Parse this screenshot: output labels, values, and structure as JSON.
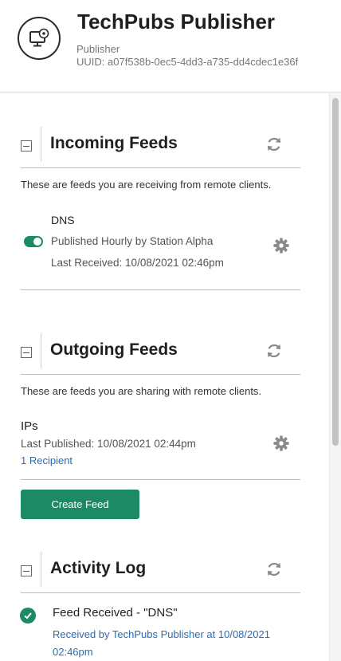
{
  "header": {
    "title": "TechPubs Publisher",
    "role": "Publisher",
    "uuid": "UUID: a07f538b-0ec5-4dd3-a735-dd4cdec1e36f",
    "logo_icon": "monitor-gear-icon"
  },
  "incoming": {
    "title": "Incoming Feeds",
    "description": "These are feeds you are receiving from remote clients.",
    "feed": {
      "name": "DNS",
      "schedule": "Published Hourly by Station Alpha",
      "last_received": "Last Received: 10/08/2021 02:46pm",
      "enabled": true
    }
  },
  "outgoing": {
    "title": "Outgoing Feeds",
    "description": "These are feeds you are sharing with remote clients.",
    "feed": {
      "name": "IPs",
      "last_published": "Last Published: 10/08/2021 02:44pm",
      "recipients": "1 Recipient"
    },
    "create_button": "Create Feed"
  },
  "activity": {
    "title": "Activity Log",
    "entries": [
      {
        "title": "Feed Received - \"DNS\"",
        "detail": "Received by TechPubs Publisher at 10/08/2021 02:46pm",
        "status": "success"
      }
    ]
  },
  "colors": {
    "accent": "#1d8a66",
    "link": "#2a6cb0"
  }
}
